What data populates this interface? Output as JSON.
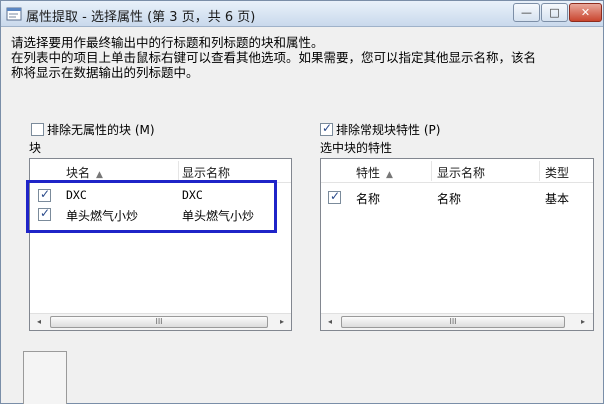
{
  "window": {
    "title": "属性提取 - 选择属性 (第 3 页，共 6 页)",
    "controls": {
      "minimize": "—",
      "maximize": "□",
      "close": "✕"
    }
  },
  "instruction": {
    "line1": "请选择要用作最终输出中的行标题和列标题的块和属性。",
    "line2": "在列表中的项目上单击鼠标右键可以查看其他选项。如果需要，您可以指定其他显示名称，该名",
    "line3": "称将显示在数据输出的列标题中。"
  },
  "left_panel": {
    "exclude_option": {
      "label": "排除无属性的块 (M)",
      "checked": false
    },
    "group_label": "块",
    "columns": {
      "block_name": "块名",
      "display_name": "显示名称"
    },
    "sort_indicator": "▲",
    "rows": [
      {
        "checked": true,
        "block_name": "DXC",
        "display_name": "DXC"
      },
      {
        "checked": true,
        "block_name": "单头燃气小炒",
        "display_name": "单头燃气小炒"
      }
    ],
    "scrollbar": {
      "left_arrow": "◂",
      "right_arrow": "▸",
      "thumb_grip": "III"
    }
  },
  "right_panel": {
    "exclude_option": {
      "label": "排除常规块特性 (P)",
      "checked": true
    },
    "group_label": "选中块的特性",
    "columns": {
      "property": "特性",
      "display_name": "显示名称",
      "type": "类型"
    },
    "sort_indicator": "▲",
    "rows": [
      {
        "checked": true,
        "property": "名称",
        "display_name": "名称",
        "type": "基本"
      }
    ],
    "scrollbar": {
      "left_arrow": "◂",
      "right_arrow": "▸",
      "thumb_grip": "III"
    }
  },
  "colors": {
    "highlight_border": "#1f24c8",
    "window_bg": "#f0f0f0"
  },
  "icons": {
    "app_icon": "window-app-icon"
  }
}
